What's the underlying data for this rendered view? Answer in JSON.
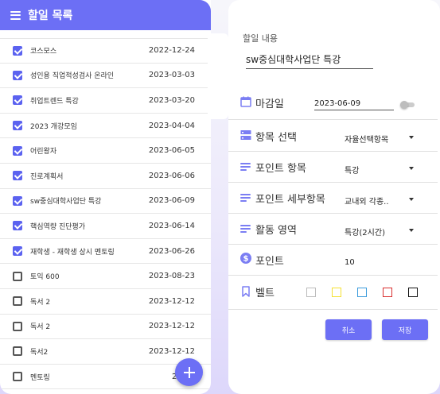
{
  "left_panel": {
    "title": "할일 목록",
    "items": [
      {
        "name": "코스모스",
        "date": "2022-12-24",
        "checked": true
      },
      {
        "name": "성인용 직업적성검사 온라인",
        "date": "2023-03-03",
        "checked": true
      },
      {
        "name": "취업트렌드 특강",
        "date": "2023-03-20",
        "checked": true
      },
      {
        "name": "2023 개강모임",
        "date": "2023-04-04",
        "checked": true
      },
      {
        "name": "어린왕자",
        "date": "2023-06-05",
        "checked": true
      },
      {
        "name": "진로계획서",
        "date": "2023-06-06",
        "checked": true
      },
      {
        "name": "sw중심대학사업단 특강",
        "date": "2023-06-09",
        "checked": true
      },
      {
        "name": "핵심역량 진단평가",
        "date": "2023-06-14",
        "checked": true
      },
      {
        "name": "재학생 - 재학생 상시 멘토링",
        "date": "2023-06-26",
        "checked": true
      },
      {
        "name": "토익 600",
        "date": "2023-08-23",
        "checked": false
      },
      {
        "name": "독서 2",
        "date": "2023-12-12",
        "checked": false
      },
      {
        "name": "독서 2",
        "date": "2023-12-12",
        "checked": false
      },
      {
        "name": "독서2",
        "date": "2023-12-12",
        "checked": false
      },
      {
        "name": "멘토링",
        "date": "2023-",
        "checked": false
      }
    ]
  },
  "right_panel": {
    "content_label": "할일 내용",
    "content_value": "sw중심대학사업단 특강",
    "deadline": {
      "label": "마감일",
      "value": "2023-06-09"
    },
    "category": {
      "label": "항목 선택",
      "value": "자율선택항목"
    },
    "point_item": {
      "label": "포인트 항목",
      "value": "특강"
    },
    "point_detail": {
      "label": "포인트 세부항목",
      "value": "교내외 각종.."
    },
    "activity": {
      "label": "활동 영역",
      "value": "특강(2시간)"
    },
    "point": {
      "label": "포인트",
      "value": "10"
    },
    "belt": {
      "label": "벨트",
      "colors": [
        "#bbbbbb",
        "#f5e133",
        "#3a9bdc",
        "#d93030",
        "#111111"
      ]
    },
    "cancel_label": "취소",
    "save_label": "저장"
  },
  "colors": {
    "accent": "#6c6ff5",
    "icon": "#7b7ef3"
  }
}
